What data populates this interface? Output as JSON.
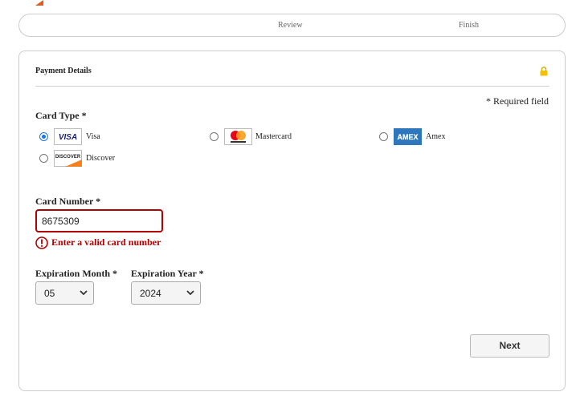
{
  "steps": {
    "review": "Review",
    "finish": "Finish"
  },
  "payment": {
    "title": "Payment Details",
    "required_note": "* Required field",
    "card_type_label": "Card Type *",
    "card_types": {
      "visa": {
        "label": "Visa",
        "logo_text": "VISA"
      },
      "mastercard": {
        "label": "Mastercard"
      },
      "amex": {
        "label": "Amex",
        "logo_text": "AMEX"
      },
      "discover": {
        "label": "Discover",
        "logo_text": "DISCOVER"
      }
    },
    "selected_card_type": "Visa",
    "card_number_label": "Card Number *",
    "card_number_value": "8675309",
    "card_number_error": "Enter a valid card number",
    "exp_month_label": "Expiration Month *",
    "exp_month_value": "05",
    "exp_year_label": "Expiration Year *",
    "exp_year_value": "2024",
    "next_button": "Next"
  },
  "colors": {
    "error": "#b30000",
    "selected_radio": "#1a73e8",
    "lock": "#f2c200",
    "brand_accent": "#e35b1b"
  }
}
